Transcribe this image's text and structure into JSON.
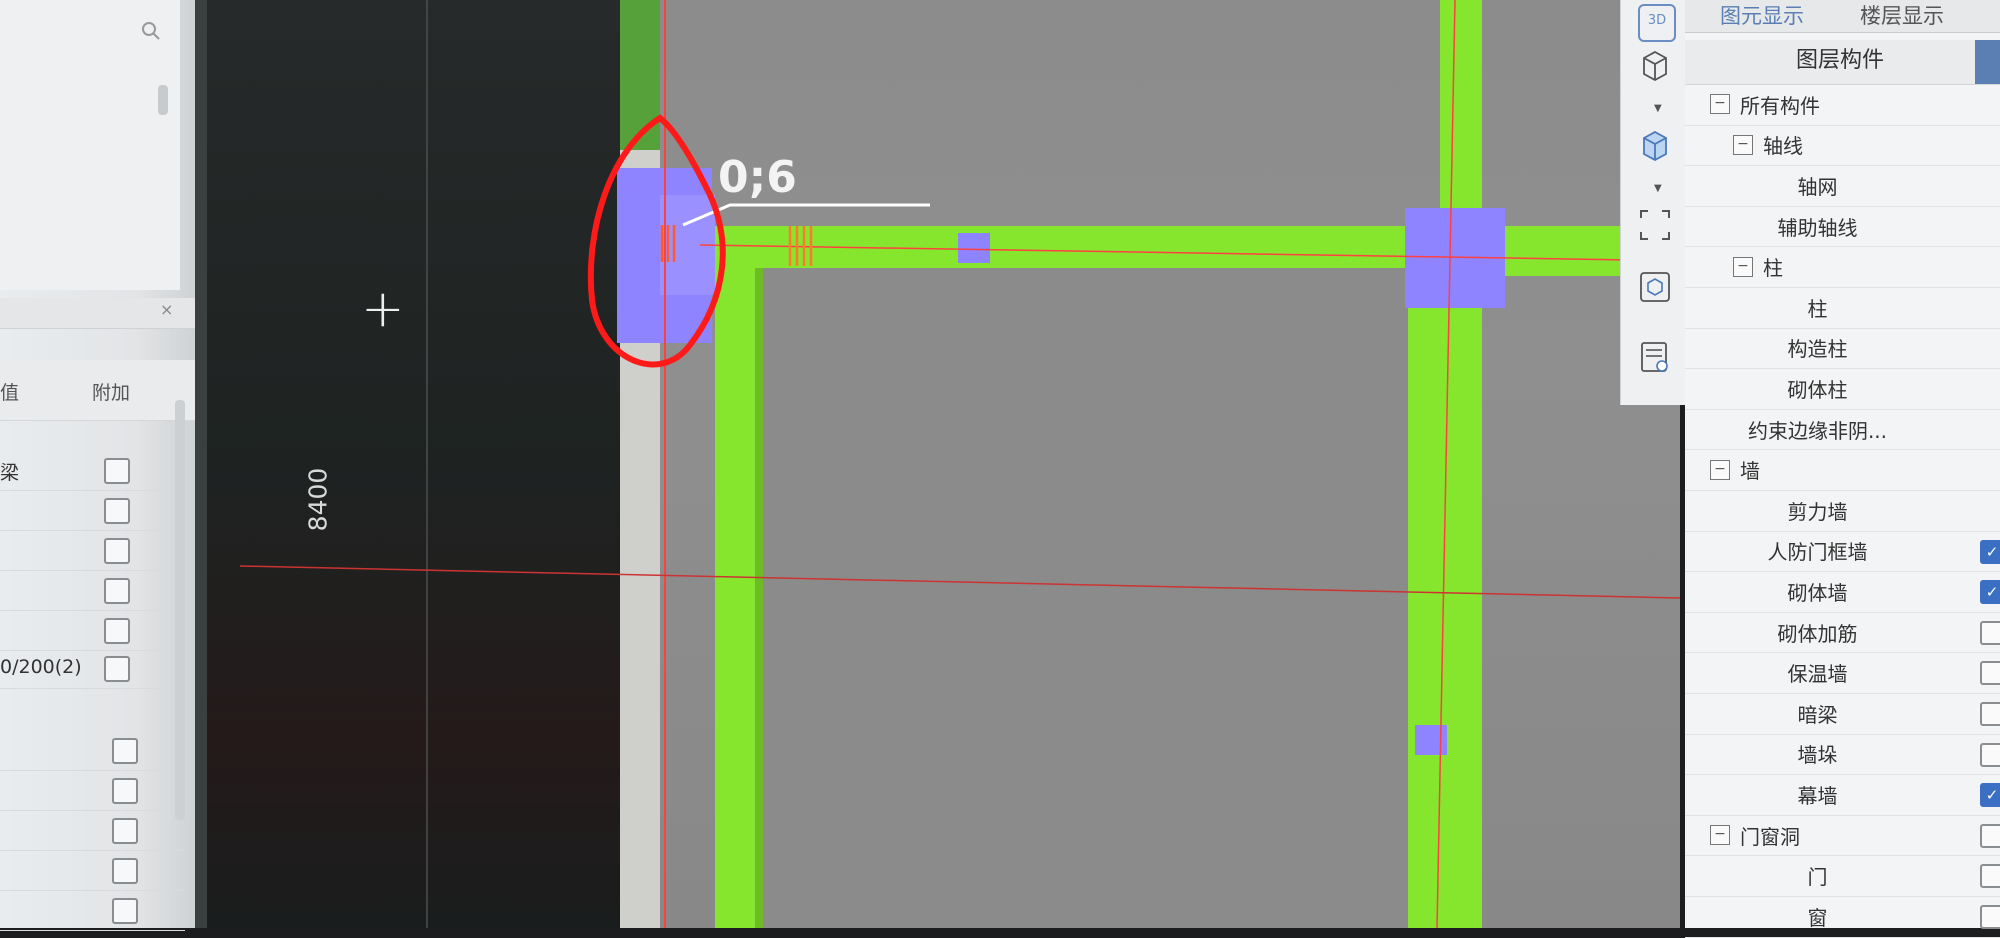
{
  "left_panel": {
    "header_col_value": "值",
    "header_col_extra": "附加",
    "rows": [
      {
        "label": "梁",
        "checked": false
      },
      {
        "label": "",
        "checked": false
      },
      {
        "label": "",
        "checked": false
      },
      {
        "label": "",
        "checked": false
      },
      {
        "label": "",
        "checked": false
      },
      {
        "label": "0/200(2)",
        "checked": false
      },
      {
        "label": "",
        "checked": false
      },
      {
        "label": "",
        "checked": false
      },
      {
        "label": "",
        "checked": false
      },
      {
        "label": "",
        "checked": false
      },
      {
        "label": "",
        "checked": false
      }
    ]
  },
  "canvas": {
    "dimension_label": "8400",
    "annotation_label": "0;6",
    "cursor_symbol": "+"
  },
  "toolbar": {
    "icon_3d": "3D"
  },
  "right_panel": {
    "tabs": [
      "图元显示",
      "楼层显示"
    ],
    "column_title": "图层构件",
    "items": [
      {
        "label": "所有构件",
        "level": 0,
        "expander": "−",
        "checked": null
      },
      {
        "label": "轴线",
        "level": 1,
        "expander": "−",
        "checked": null
      },
      {
        "label": "轴网",
        "level": 2,
        "expander": "",
        "checked": null
      },
      {
        "label": "辅助轴线",
        "level": 2,
        "expander": "",
        "checked": null
      },
      {
        "label": "柱",
        "level": 1,
        "expander": "−",
        "checked": null
      },
      {
        "label": "柱",
        "level": 2,
        "expander": "",
        "checked": null
      },
      {
        "label": "构造柱",
        "level": 2,
        "expander": "",
        "checked": null
      },
      {
        "label": "砌体柱",
        "level": 2,
        "expander": "",
        "checked": null
      },
      {
        "label": "约束边缘非阴...",
        "level": 2,
        "expander": "",
        "checked": null
      },
      {
        "label": "墙",
        "level": 0,
        "expander": "−",
        "checked": null
      },
      {
        "label": "剪力墙",
        "level": 2,
        "expander": "",
        "checked": null
      },
      {
        "label": "人防门框墙",
        "level": 2,
        "expander": "",
        "checked": true
      },
      {
        "label": "砌体墙",
        "level": 2,
        "expander": "",
        "checked": true
      },
      {
        "label": "砌体加筋",
        "level": 2,
        "expander": "",
        "checked": false
      },
      {
        "label": "保温墙",
        "level": 2,
        "expander": "",
        "checked": false
      },
      {
        "label": "暗梁",
        "level": 2,
        "expander": "",
        "checked": false
      },
      {
        "label": "墙垛",
        "level": 2,
        "expander": "",
        "checked": false
      },
      {
        "label": "幕墙",
        "level": 2,
        "expander": "",
        "checked": true
      },
      {
        "label": "门窗洞",
        "level": 0,
        "expander": "−",
        "checked": false
      },
      {
        "label": "门",
        "level": 2,
        "expander": "",
        "checked": false
      },
      {
        "label": "窗",
        "level": 2,
        "expander": "",
        "checked": false
      }
    ]
  },
  "colors": {
    "beam_green": "#86e62e",
    "column_purple": "#8f84ff",
    "axis_red": "#ff3b3b",
    "marker_red": "#ff1a1a",
    "tab_blue": "#5b7fb2"
  }
}
